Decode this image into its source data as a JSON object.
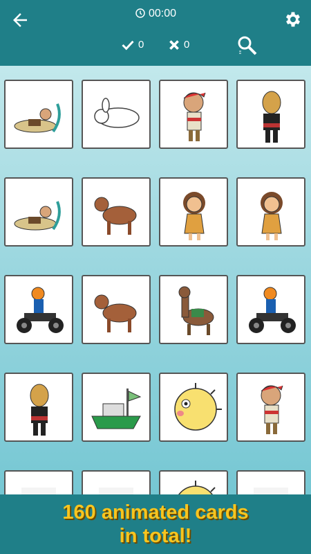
{
  "header": {
    "timer": "00:00",
    "correct_count": "0",
    "wrong_count": "0"
  },
  "cards": [
    {
      "icon": "sleeping-explorer-icon"
    },
    {
      "icon": "sketch-rabbit-icon"
    },
    {
      "icon": "pirate-icon"
    },
    {
      "icon": "bald-man-icon"
    },
    {
      "icon": "sleeping-explorer-icon"
    },
    {
      "icon": "hyena-icon"
    },
    {
      "icon": "cave-girl-icon"
    },
    {
      "icon": "cave-girl-icon"
    },
    {
      "icon": "quad-bike-rider-icon"
    },
    {
      "icon": "hyena-icon"
    },
    {
      "icon": "llama-icon"
    },
    {
      "icon": "quad-bike-rider-icon"
    },
    {
      "icon": "bald-man-icon"
    },
    {
      "icon": "boat-icon"
    },
    {
      "icon": "pufferfish-icon"
    },
    {
      "icon": "pirate-icon"
    },
    {
      "icon": "partial-card-icon"
    },
    {
      "icon": "partial-card-icon"
    },
    {
      "icon": "pufferfish-icon"
    },
    {
      "icon": "partial-card-icon"
    }
  ],
  "banner": {
    "line1": "160 animated cards",
    "line2": "in total!"
  },
  "colors": {
    "header": "#1f7f88",
    "banner_text": "#f8c51f"
  }
}
